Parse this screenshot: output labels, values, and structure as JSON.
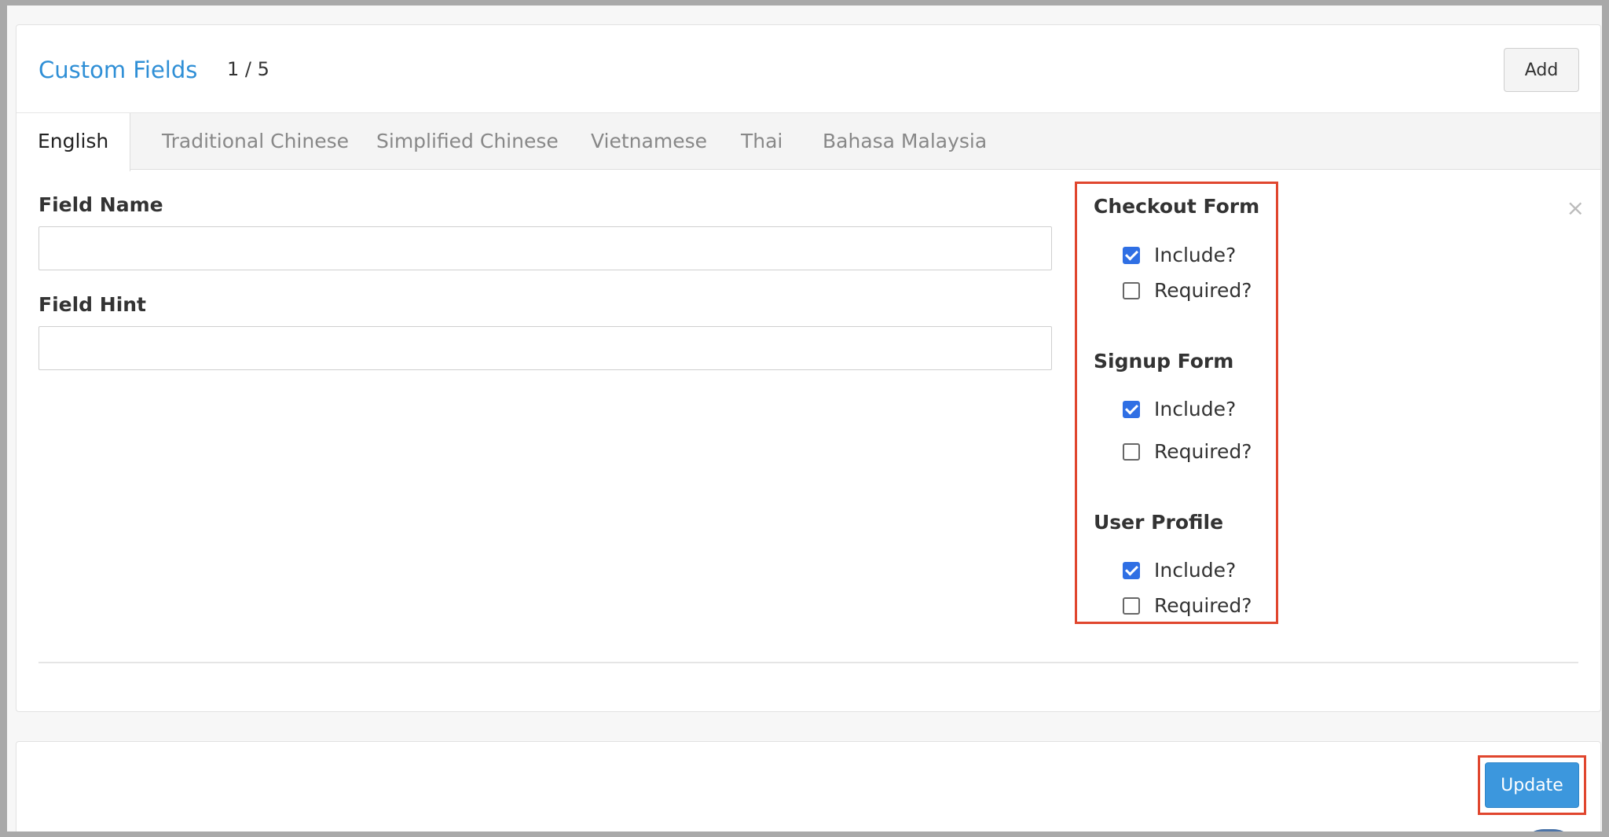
{
  "header": {
    "title": "Custom Fields",
    "counter": "1 / 5",
    "add_label": "Add"
  },
  "tabs": [
    {
      "label": "English",
      "active": true
    },
    {
      "label": "Traditional Chinese",
      "active": false
    },
    {
      "label": "Simplified Chinese",
      "active": false
    },
    {
      "label": "Vietnamese",
      "active": false
    },
    {
      "label": "Thai",
      "active": false
    },
    {
      "label": "Bahasa Malaysia",
      "active": false
    }
  ],
  "fields": {
    "field_name_label": "Field Name",
    "field_name_value": "",
    "field_hint_label": "Field Hint",
    "field_hint_value": ""
  },
  "close_icon": "×",
  "forms": [
    {
      "title": "Checkout Form",
      "include_label": "Include?",
      "include_checked": true,
      "required_label": "Required?",
      "required_checked": false
    },
    {
      "title": "Signup Form",
      "include_label": "Include?",
      "include_checked": true,
      "required_label": "Required?",
      "required_checked": false
    },
    {
      "title": "User Profile",
      "include_label": "Include?",
      "include_checked": true,
      "required_label": "Required?",
      "required_checked": false
    }
  ],
  "footer": {
    "update_label": "Update"
  },
  "colors": {
    "accent": "#2f8fd6",
    "checkbox": "#2f6fe4",
    "highlight": "#e0462e",
    "update_button": "#3c97dd"
  }
}
